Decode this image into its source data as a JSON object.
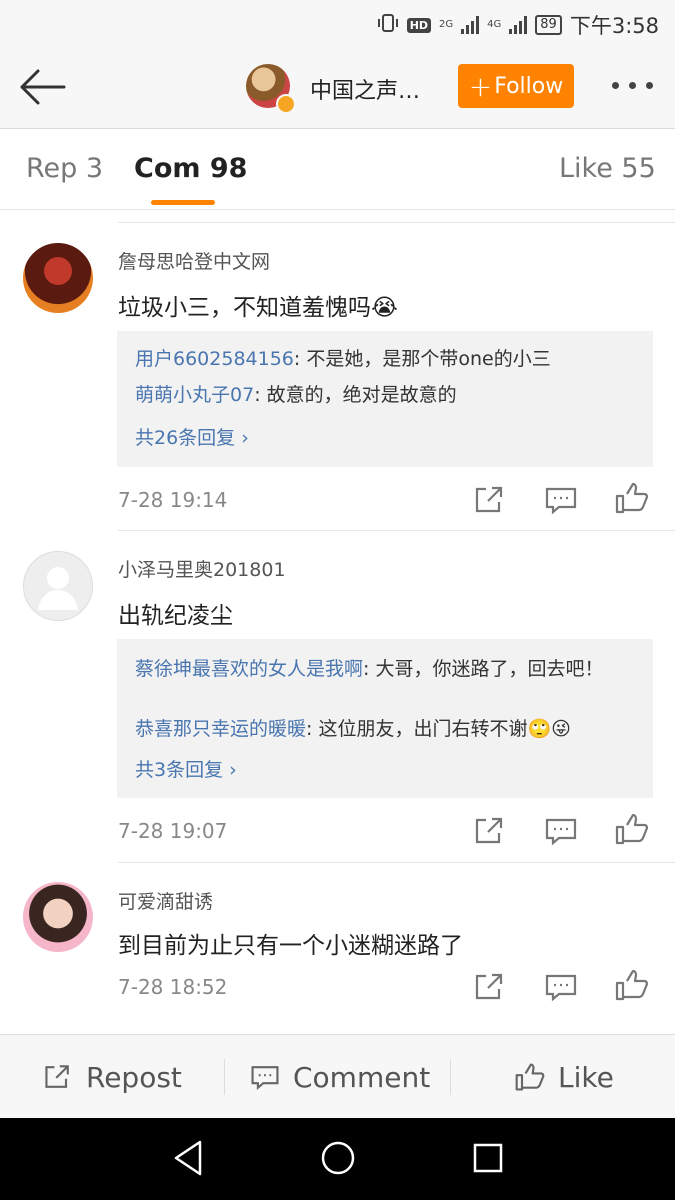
{
  "status_bar": {
    "hd": "HD",
    "net1": "2G",
    "net2": "4G",
    "battery": "89",
    "time": "下午3:58"
  },
  "header": {
    "title": "中国之声…",
    "follow_label": "Follow",
    "follow_plus": "+"
  },
  "tabs": [
    {
      "label": "Rep 3"
    },
    {
      "label": "Com 98"
    },
    {
      "label": "Like 55"
    }
  ],
  "comments": [
    {
      "user": "詹母思哈登中文网",
      "text": "垃圾小三，不知道羞愧吗😭",
      "replies": [
        {
          "user": "用户6602584156",
          "sep": ": ",
          "text": "不是她，是那个带one的小三"
        },
        {
          "user": "萌萌小丸子07",
          "sep": ": ",
          "text": "故意的，绝对是故意的"
        }
      ],
      "more_replies": "共26条回复 ›",
      "time": "7-28 19:14"
    },
    {
      "user": "小泽马里奥201801",
      "text": "出轨纪凌尘",
      "replies": [
        {
          "user": "蔡徐坤最喜欢的女人是我啊",
          "sep": ": ",
          "text": "大哥，你迷路了，回去吧！"
        },
        {
          "user": "恭喜那只幸运的暖暖",
          "sep": ": ",
          "text": "这位朋友，出门右转不谢🙄😜"
        }
      ],
      "more_replies": "共3条回复 ›",
      "time": "7-28 19:07"
    },
    {
      "user": "可爱滴甜诱",
      "text": "到目前为止只有一个小迷糊迷路了",
      "time": "7-28 18:52"
    }
  ],
  "bottom_bar": {
    "repost": "Repost",
    "comment": "Comment",
    "like": "Like"
  },
  "colors": {
    "accent": "#ff8200",
    "link": "#4a76b0"
  }
}
